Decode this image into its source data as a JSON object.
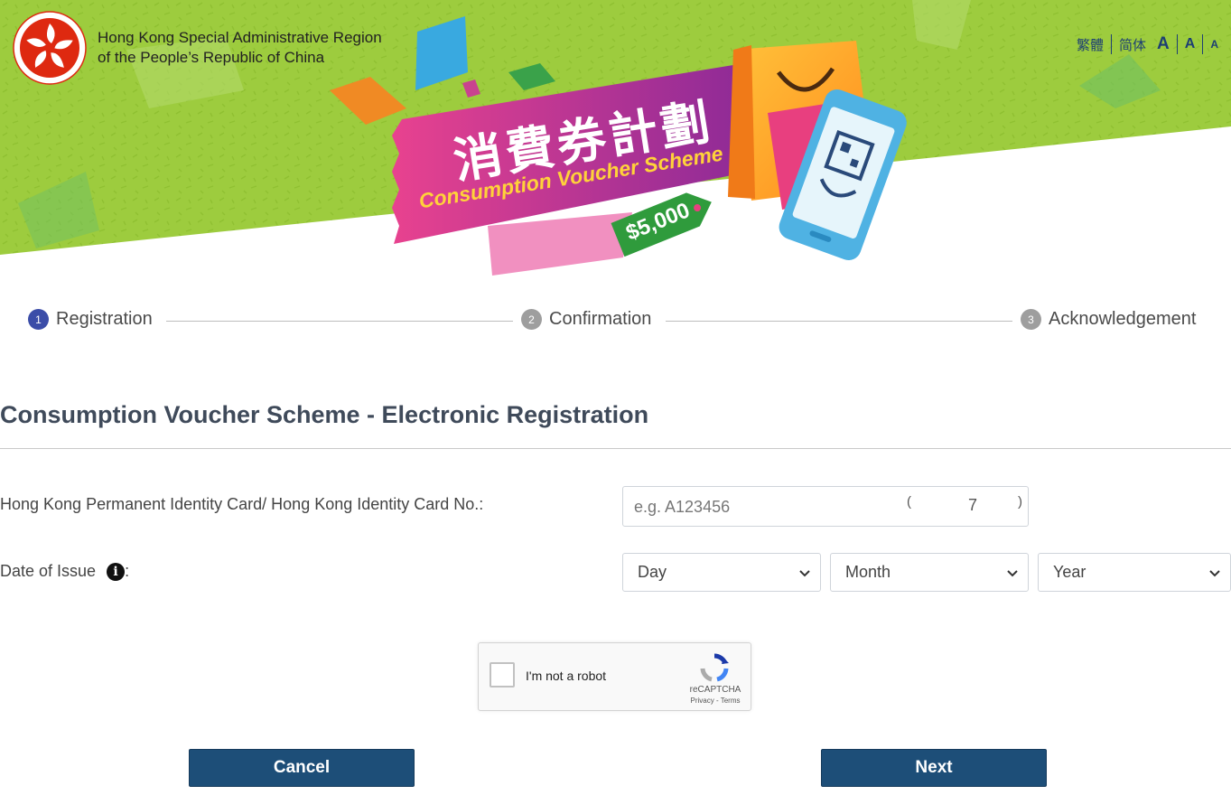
{
  "header": {
    "gov_line1": "Hong Kong Special Administrative Region",
    "gov_line2": "of the People’s Republic of China",
    "banner_title_zh": "消費券計劃",
    "banner_title_en": "Consumption Voucher Scheme",
    "banner_amount": "$5,000",
    "colors": {
      "banner_green": "#9dcc3e",
      "ribbon_pink": "#e0418f",
      "ribbon_purple": "#9a2c95",
      "tag_green": "#2f9b3c"
    }
  },
  "language_bar": {
    "traditional": "繁體",
    "simplified": "简体",
    "font_large": "A",
    "font_medium": "A",
    "font_small": "A"
  },
  "stepper": {
    "steps": [
      {
        "num": "1",
        "label": "Registration",
        "active": true
      },
      {
        "num": "2",
        "label": "Confirmation",
        "active": false
      },
      {
        "num": "3",
        "label": "Acknowledgement",
        "active": false
      }
    ]
  },
  "form": {
    "title": "Consumption Voucher Scheme - Electronic Registration",
    "id_label": "Hong Kong Permanent Identity Card/ Hong Kong Identity Card No.:",
    "id_placeholder": "e.g. A123456",
    "paren_open": "(",
    "check_digit": "7",
    "paren_close": ")",
    "date_label": "Date of Issue",
    "date_label_suffix": ":",
    "info_icon_glyph": "i",
    "day": "Day",
    "month": "Month",
    "year": "Year"
  },
  "captcha": {
    "label": "I'm not a robot",
    "brand": "reCAPTCHA",
    "links": "Privacy - Terms"
  },
  "buttons": {
    "cancel": "Cancel",
    "next": "Next",
    "color": "#1d4e78"
  }
}
